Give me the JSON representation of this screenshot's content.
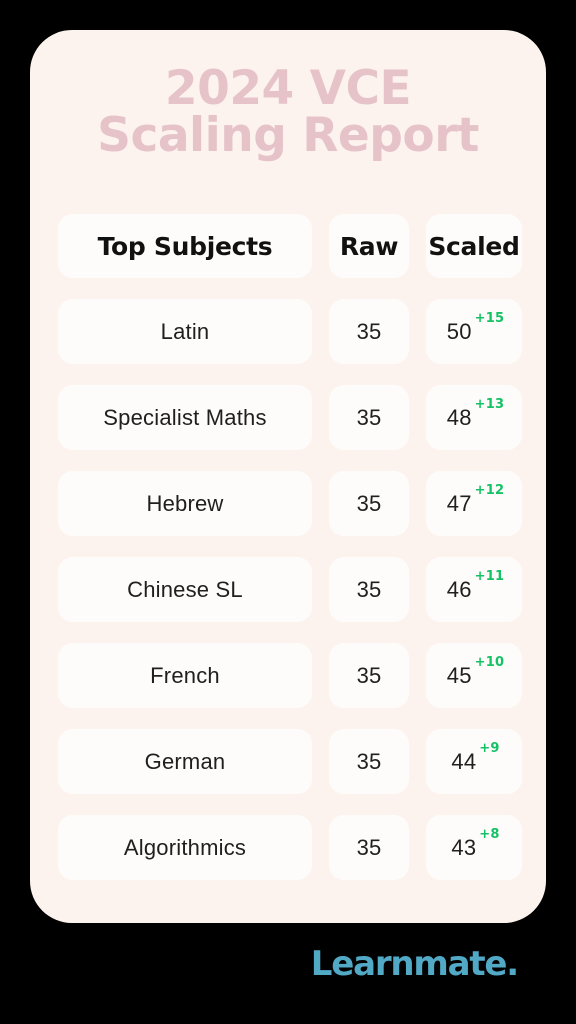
{
  "title": {
    "line1": "2024 VCE",
    "line2": "Scaling Report"
  },
  "table": {
    "headers": {
      "subject": "Top Subjects",
      "raw": "Raw",
      "scaled": "Scaled"
    },
    "rows": [
      {
        "subject": "Latin",
        "raw": "35",
        "scaled": "50",
        "delta": "+15"
      },
      {
        "subject": "Specialist Maths",
        "raw": "35",
        "scaled": "48",
        "delta": "+13"
      },
      {
        "subject": "Hebrew",
        "raw": "35",
        "scaled": "47",
        "delta": "+12"
      },
      {
        "subject": "Chinese SL",
        "raw": "35",
        "scaled": "46",
        "delta": "+11"
      },
      {
        "subject": "French",
        "raw": "35",
        "scaled": "45",
        "delta": "+10"
      },
      {
        "subject": "German",
        "raw": "35",
        "scaled": "44",
        "delta": "+9"
      },
      {
        "subject": "Algorithmics",
        "raw": "35",
        "scaled": "43",
        "delta": "+8"
      }
    ]
  },
  "logo": {
    "text": "Learnmate."
  },
  "colors": {
    "background": "#000000",
    "card": "#FDF3EE",
    "cell": "#FEFCFA",
    "title": "#E6C3C9",
    "delta": "#14C265",
    "logo": "#52A9C6",
    "text": "#1F1F1F"
  }
}
